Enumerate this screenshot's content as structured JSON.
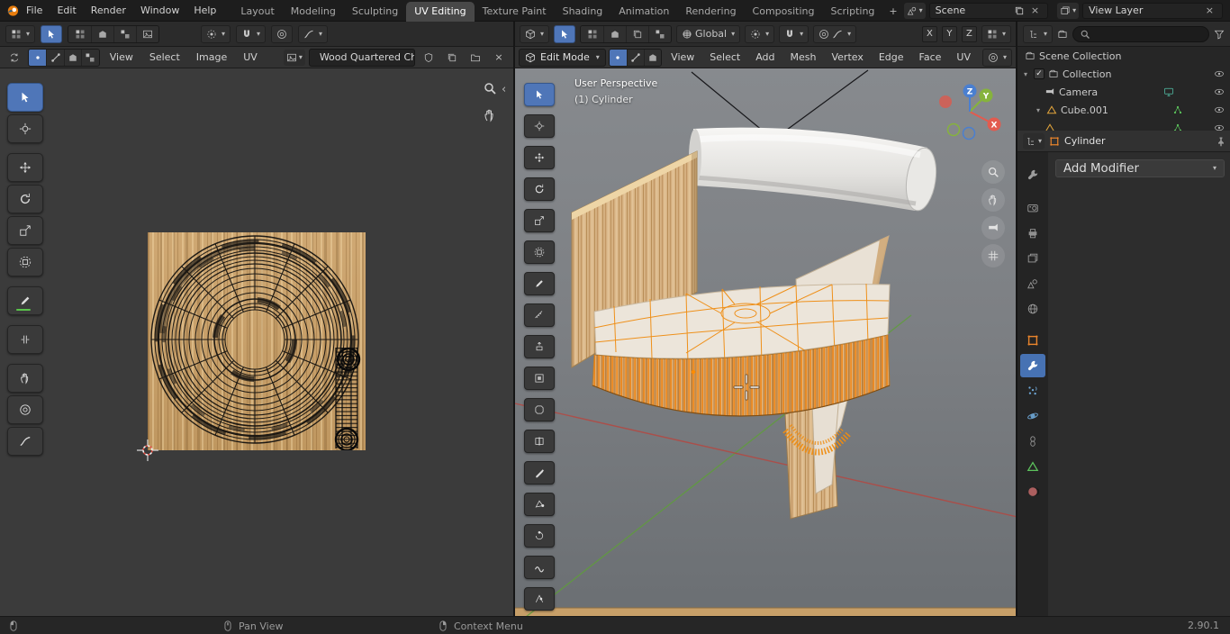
{
  "colors": {
    "accent_blue": "#4f76b8",
    "selection_orange": "#ef8c10",
    "object_orange": "#e8842c",
    "axis_x_red": "#e25b4f",
    "axis_y_green": "#86b33c",
    "axis_z_blue": "#4a7fd0",
    "wood": "#cda770",
    "viewport_gray": "#7d8084"
  },
  "icons": {
    "caret": "▾",
    "collapse": "‹",
    "close": "×",
    "plus": "+",
    "check": "✓"
  },
  "topbar": {
    "menus": [
      "File",
      "Edit",
      "Render",
      "Window",
      "Help"
    ],
    "tabs": [
      "Layout",
      "Modeling",
      "Sculpting",
      "UV Editing",
      "Texture Paint",
      "Shading",
      "Animation",
      "Rendering",
      "Compositing",
      "Scripting"
    ],
    "active_tab": "UV Editing",
    "scene_field": {
      "label": "Scene"
    },
    "view_layer_field": {
      "label": "View Layer"
    }
  },
  "uv_editor": {
    "header_menus": [
      "View",
      "Select",
      "Image",
      "UV"
    ],
    "image_name": "Wood Quartered Chi...",
    "tools": [
      "Tweak",
      "Cursor",
      "Move",
      "Rotate",
      "Scale",
      "Transform",
      "Annotate",
      "Rip Region",
      "Grab",
      "Relax",
      "Pinch"
    ]
  },
  "viewport": {
    "mode": "Edit Mode",
    "orientation": "Global",
    "axes": [
      "X",
      "Y",
      "Z"
    ],
    "menus": [
      "View",
      "Select",
      "Add",
      "Mesh",
      "Vertex",
      "Edge",
      "Face",
      "UV"
    ],
    "overlay": {
      "view": "User Perspective",
      "object": "(1) Cylinder"
    },
    "gizmo": {
      "x": "X",
      "y": "Y",
      "z": "Z"
    },
    "tools": [
      "Select Box",
      "Cursor",
      "Move",
      "Rotate",
      "Scale",
      "Transform",
      "Annotate",
      "Measure",
      "Extrude Region",
      "Inset Faces",
      "Bevel",
      "Loop Cut",
      "Knife",
      "Poly Build",
      "Spin",
      "Smooth",
      "Edge Slide"
    ]
  },
  "outliner": {
    "rows": [
      {
        "label": "Scene Collection"
      },
      {
        "label": "Collection"
      },
      {
        "label": "Camera"
      },
      {
        "label": "Cube.001"
      }
    ]
  },
  "properties": {
    "breadcrumb": "Cylinder",
    "add_modifier": "Add Modifier",
    "tabs": [
      "Tool",
      "Render",
      "Output",
      "View Layer",
      "Scene",
      "World",
      "Object",
      "Modifiers",
      "Particles",
      "Physics",
      "Constraints",
      "Object Data",
      "Material"
    ]
  },
  "status_bar": {
    "pan": "Pan View",
    "context_menu": "Context Menu",
    "version": "2.90.1"
  }
}
